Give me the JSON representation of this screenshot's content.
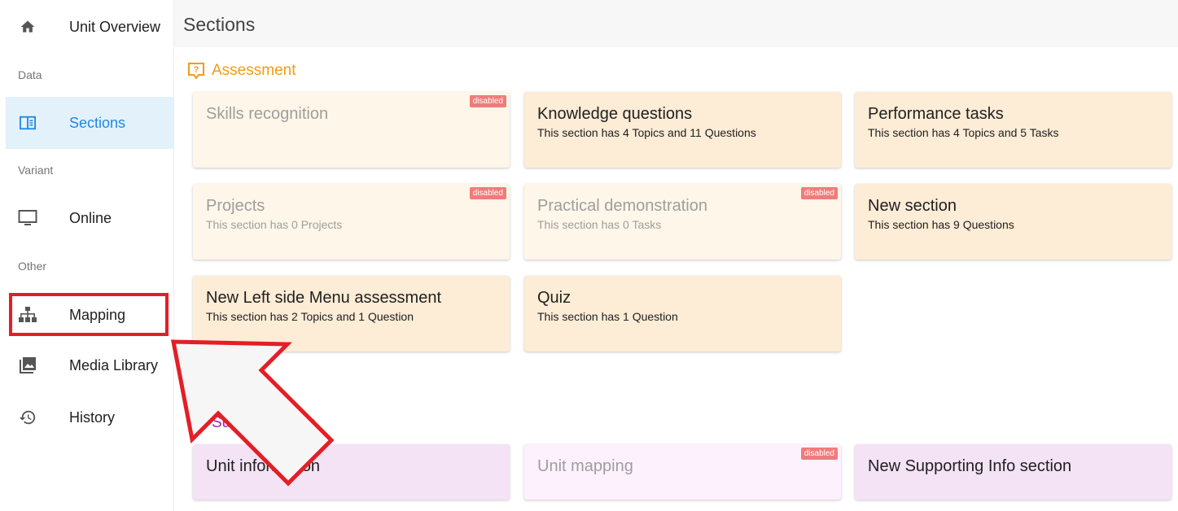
{
  "sidebar": {
    "items": [
      {
        "label": "Unit Overview",
        "icon": "home-icon"
      },
      {
        "label": "Sections",
        "icon": "book-open-icon"
      },
      {
        "label": "Online",
        "icon": "monitor-icon"
      },
      {
        "label": "Mapping",
        "icon": "sitemap-icon"
      },
      {
        "label": "Media Library",
        "icon": "photo-library-icon"
      },
      {
        "label": "History",
        "icon": "history-icon"
      }
    ],
    "groups": {
      "data": "Data",
      "variant": "Variant",
      "other": "Other"
    }
  },
  "header": {
    "title": "Sections"
  },
  "assessment": {
    "heading": "Assessment",
    "cards": [
      {
        "title": "Skills recognition",
        "subtitle": "",
        "badge": "disabled"
      },
      {
        "title": "Knowledge questions",
        "subtitle": "This section has 4 Topics and 11 Questions"
      },
      {
        "title": "Performance tasks",
        "subtitle": "This section has 4 Topics and 5 Tasks"
      },
      {
        "title": "Projects",
        "subtitle": "This section has 0 Projects",
        "badge": "disabled"
      },
      {
        "title": "Practical demonstration",
        "subtitle": "This section has 0 Tasks",
        "badge": "disabled"
      },
      {
        "title": "New section",
        "subtitle": "This section has 9 Questions"
      },
      {
        "title": "New Left side Menu assessment",
        "subtitle": "This section has 2 Topics and 1 Question"
      },
      {
        "title": "Quiz",
        "subtitle": "This section has 1 Question"
      }
    ]
  },
  "supporting": {
    "heading": "Supporting info",
    "cards": [
      {
        "title": "Unit information"
      },
      {
        "title": "Unit mapping",
        "badge": "disabled"
      },
      {
        "title": "New Supporting Info section"
      }
    ]
  },
  "colors": {
    "accent": "#1e88e5",
    "assessment": "#f39c12",
    "supporting": "#9c27b0",
    "highlight": "#e41e26"
  }
}
